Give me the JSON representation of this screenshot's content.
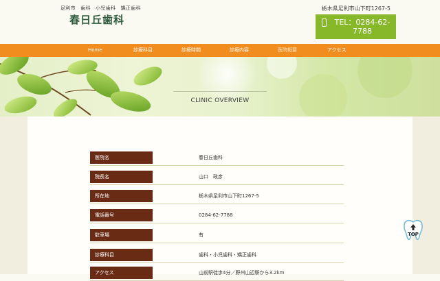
{
  "header": {
    "tagline": "足利市　歯科　小児歯科　矯正歯科",
    "clinic_name": "春日丘歯科",
    "address": "栃木県足利市山下町1267-5",
    "tel_label": "TEL：0284-62-7788"
  },
  "nav": {
    "items": [
      {
        "label": "Home"
      },
      {
        "label": "診療科目"
      },
      {
        "label": "診療時間"
      },
      {
        "label": "診療内容"
      },
      {
        "label": "医院概要"
      },
      {
        "label": "アクセス"
      }
    ],
    "active_label": "医院概要"
  },
  "hero": {
    "title": "CLINIC OVERVIEW"
  },
  "info": {
    "rows": [
      {
        "label": "医院名",
        "value": "春日丘歯科"
      },
      {
        "label": "院長名",
        "value": "山口　政彦"
      },
      {
        "label": "所在地",
        "value": "栃木県足利市山下町1267-5"
      },
      {
        "label": "電話番号",
        "value": "0284-62-7788"
      },
      {
        "label": "駐車場",
        "value": "有"
      },
      {
        "label": "診療科目",
        "value": "歯科・小児歯科・矯正歯科"
      },
      {
        "label": "アクセス",
        "value": "山前駅徒歩4分／野州山辺駅から3.2km"
      }
    ]
  },
  "top_button": {
    "label": "TOP"
  },
  "colors": {
    "accent_orange": "#f08d1e",
    "tel_green": "#86b82a",
    "label_brown": "#6a2b15",
    "logo_green": "#2d5a3c"
  },
  "icons": [
    "phone-icon",
    "tooth-top-icon",
    "leaf-branch-decoration"
  ]
}
